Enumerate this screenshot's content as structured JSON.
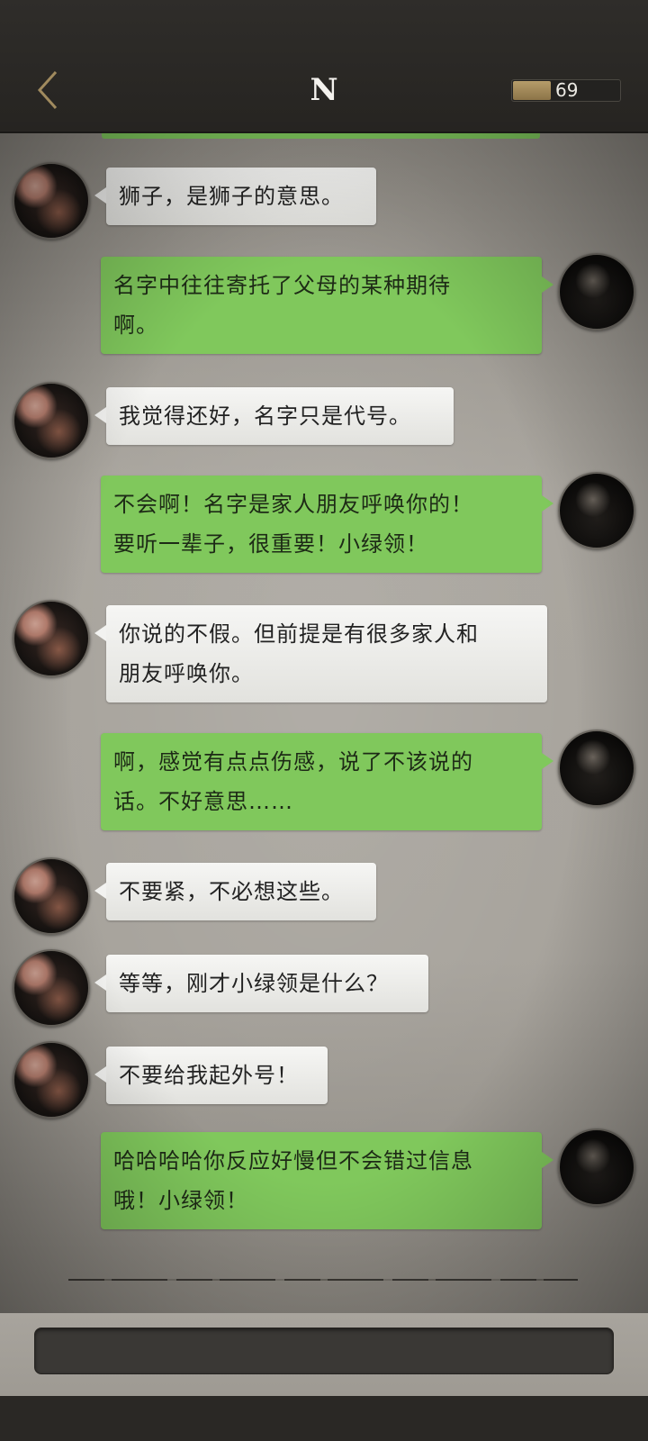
{
  "header": {
    "title": "N",
    "energy_value": "69",
    "energy_fraction": 0.35
  },
  "messages": [
    {
      "from": "other",
      "text": "狮子，是狮子的意思。"
    },
    {
      "from": "self",
      "lines": [
        "名字中往往寄托了父母的某种期待",
        "啊。"
      ]
    },
    {
      "from": "other",
      "text": "我觉得还好，名字只是代号。"
    },
    {
      "from": "self",
      "lines": [
        "不会啊！名字是家人朋友呼唤你的！",
        "要听一辈子，很重要！小绿领！"
      ]
    },
    {
      "from": "other",
      "lines": [
        "你说的不假。但前提是有很多家人和",
        "朋友呼唤你。"
      ]
    },
    {
      "from": "self",
      "lines": [
        "啊，感觉有点点伤感，说了不该说的",
        "话。不好意思……"
      ]
    },
    {
      "from": "other",
      "text": "不要紧，不必想这些。"
    },
    {
      "from": "other",
      "text": "等等，刚才小绿领是什么？"
    },
    {
      "from": "other",
      "text": "不要给我起外号！"
    },
    {
      "from": "self",
      "lines": [
        "哈哈哈哈你反应好慢但不会错过信息",
        "哦！小绿领！"
      ]
    }
  ],
  "colors": {
    "self_bubble": "#80c85c",
    "other_bubble": "#f2f2f0",
    "header_bg": "#2f2d2a",
    "accent_gold": "#b69d6a"
  },
  "icons": {
    "back": "chevron-left-icon"
  }
}
